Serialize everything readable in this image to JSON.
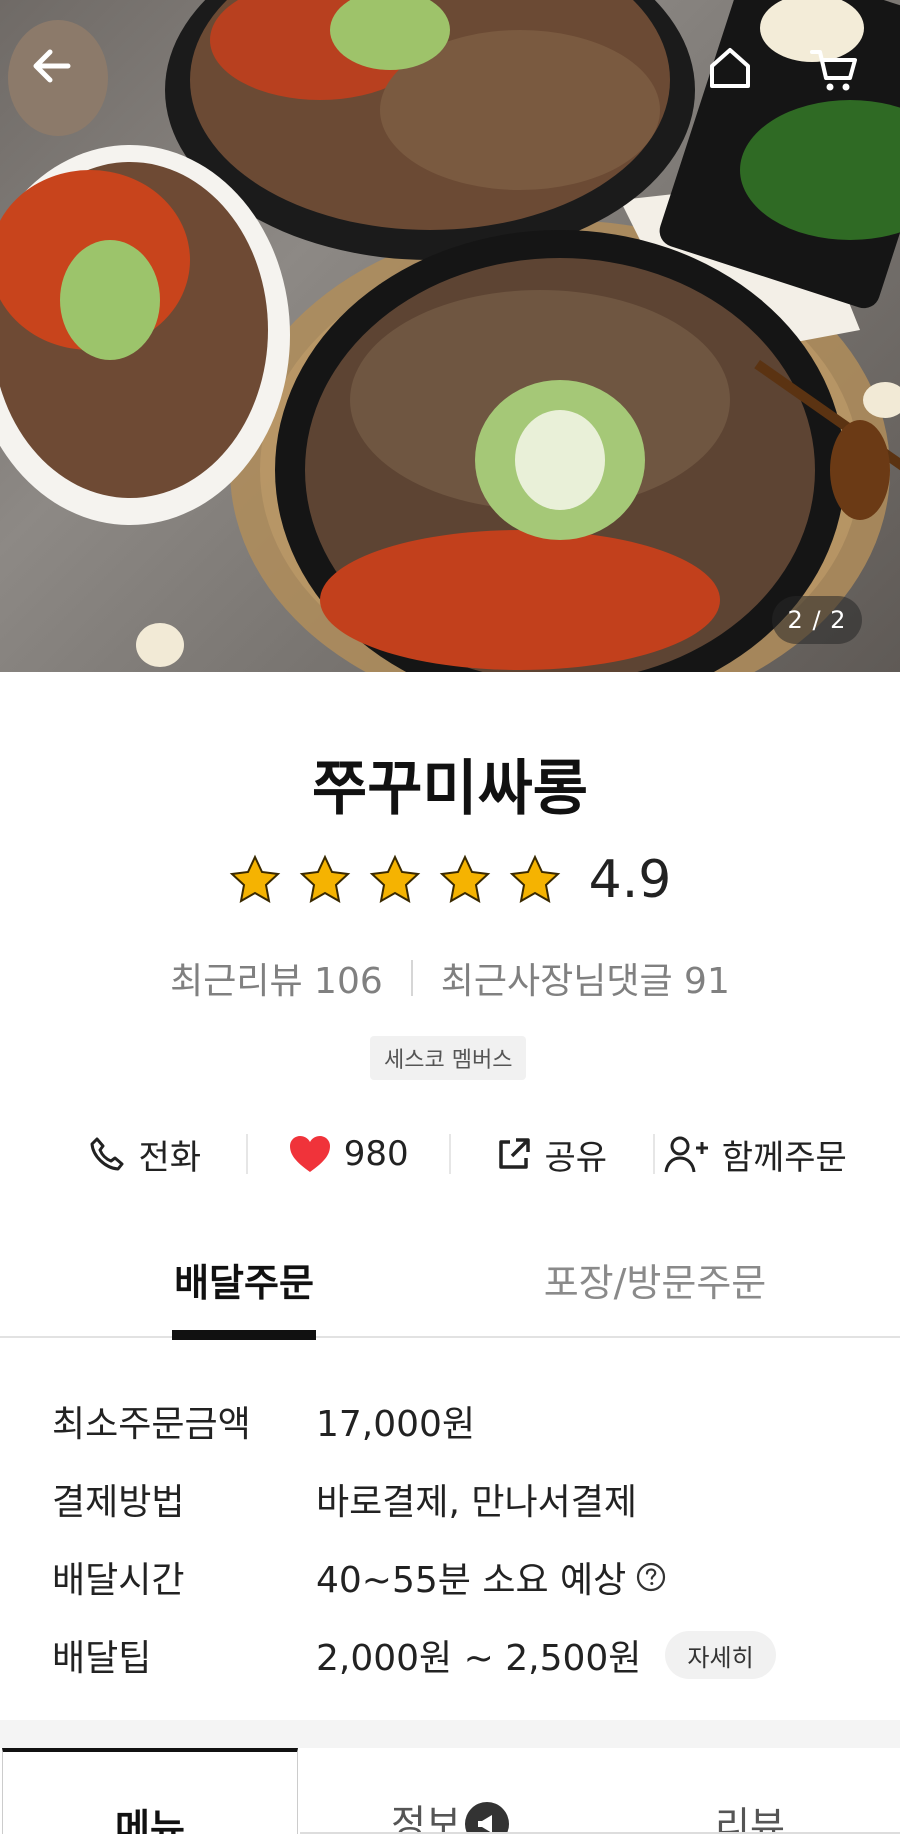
{
  "hero": {
    "page_counter": "2 / 2",
    "icons": {
      "back": "arrow-left-icon",
      "home": "home-icon",
      "cart": "cart-icon"
    }
  },
  "store": {
    "name": "쭈꾸미싸롱",
    "rating": "4.9",
    "star_count": 5,
    "recent_reviews": "최근리뷰 106",
    "recent_owner_replies": "최근사장님댓글 91",
    "badge": "세스코 멤버스"
  },
  "actions": {
    "call": "전화",
    "likes": "980",
    "share": "공유",
    "group_order": "함께주문"
  },
  "order_tabs": {
    "delivery": "배달주문",
    "pickup": "포장/방문주문"
  },
  "info": {
    "min_order_label": "최소주문금액",
    "min_order_value": "17,000원",
    "payment_label": "결제방법",
    "payment_value": "바로결제, 만나서결제",
    "delivery_time_label": "배달시간",
    "delivery_time_value": "40~55분 소요 예상",
    "delivery_tip_label": "배달팁",
    "delivery_tip_value": "2,000원 ~ 2,500원",
    "detail_button": "자세히"
  },
  "bottom_tabs": {
    "menu": "메뉴",
    "info": "정보",
    "review": "리뷰"
  },
  "colors": {
    "star": "#f5b301",
    "heart": "#f0333a",
    "active": "#111111",
    "muted": "#808080"
  }
}
